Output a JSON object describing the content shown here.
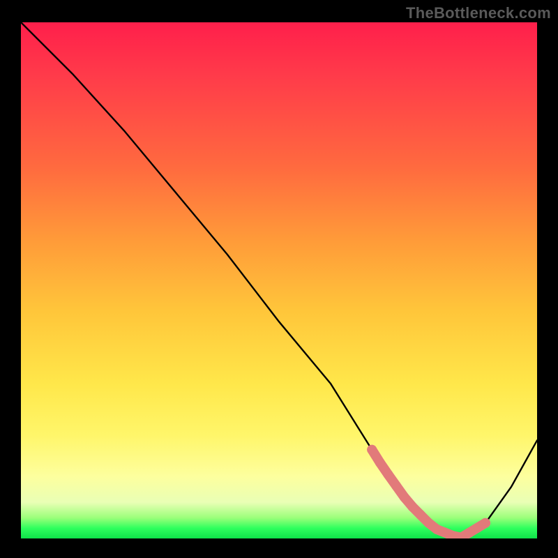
{
  "attribution": "TheBottleneck.com",
  "chart_data": {
    "type": "line",
    "title": "",
    "xlabel": "",
    "ylabel": "",
    "xlim": [
      0,
      100
    ],
    "ylim": [
      0,
      100
    ],
    "series": [
      {
        "name": "curve",
        "x": [
          0,
          10,
          20,
          30,
          40,
          50,
          60,
          65,
          70,
          75,
          80,
          85,
          90,
          95,
          100
        ],
        "values": [
          100,
          90,
          79,
          67,
          55,
          42,
          30,
          22,
          14,
          7,
          2,
          0,
          3,
          10,
          19
        ]
      }
    ],
    "highlight_band": {
      "x_start": 68,
      "x_end": 90,
      "color": "#e27a7a"
    },
    "gradient_colors": {
      "top": "#ff1f4b",
      "mid_high": "#ff9a39",
      "mid": "#ffe74a",
      "mid_low": "#fdff9e",
      "bottom": "#0fe24a"
    }
  }
}
